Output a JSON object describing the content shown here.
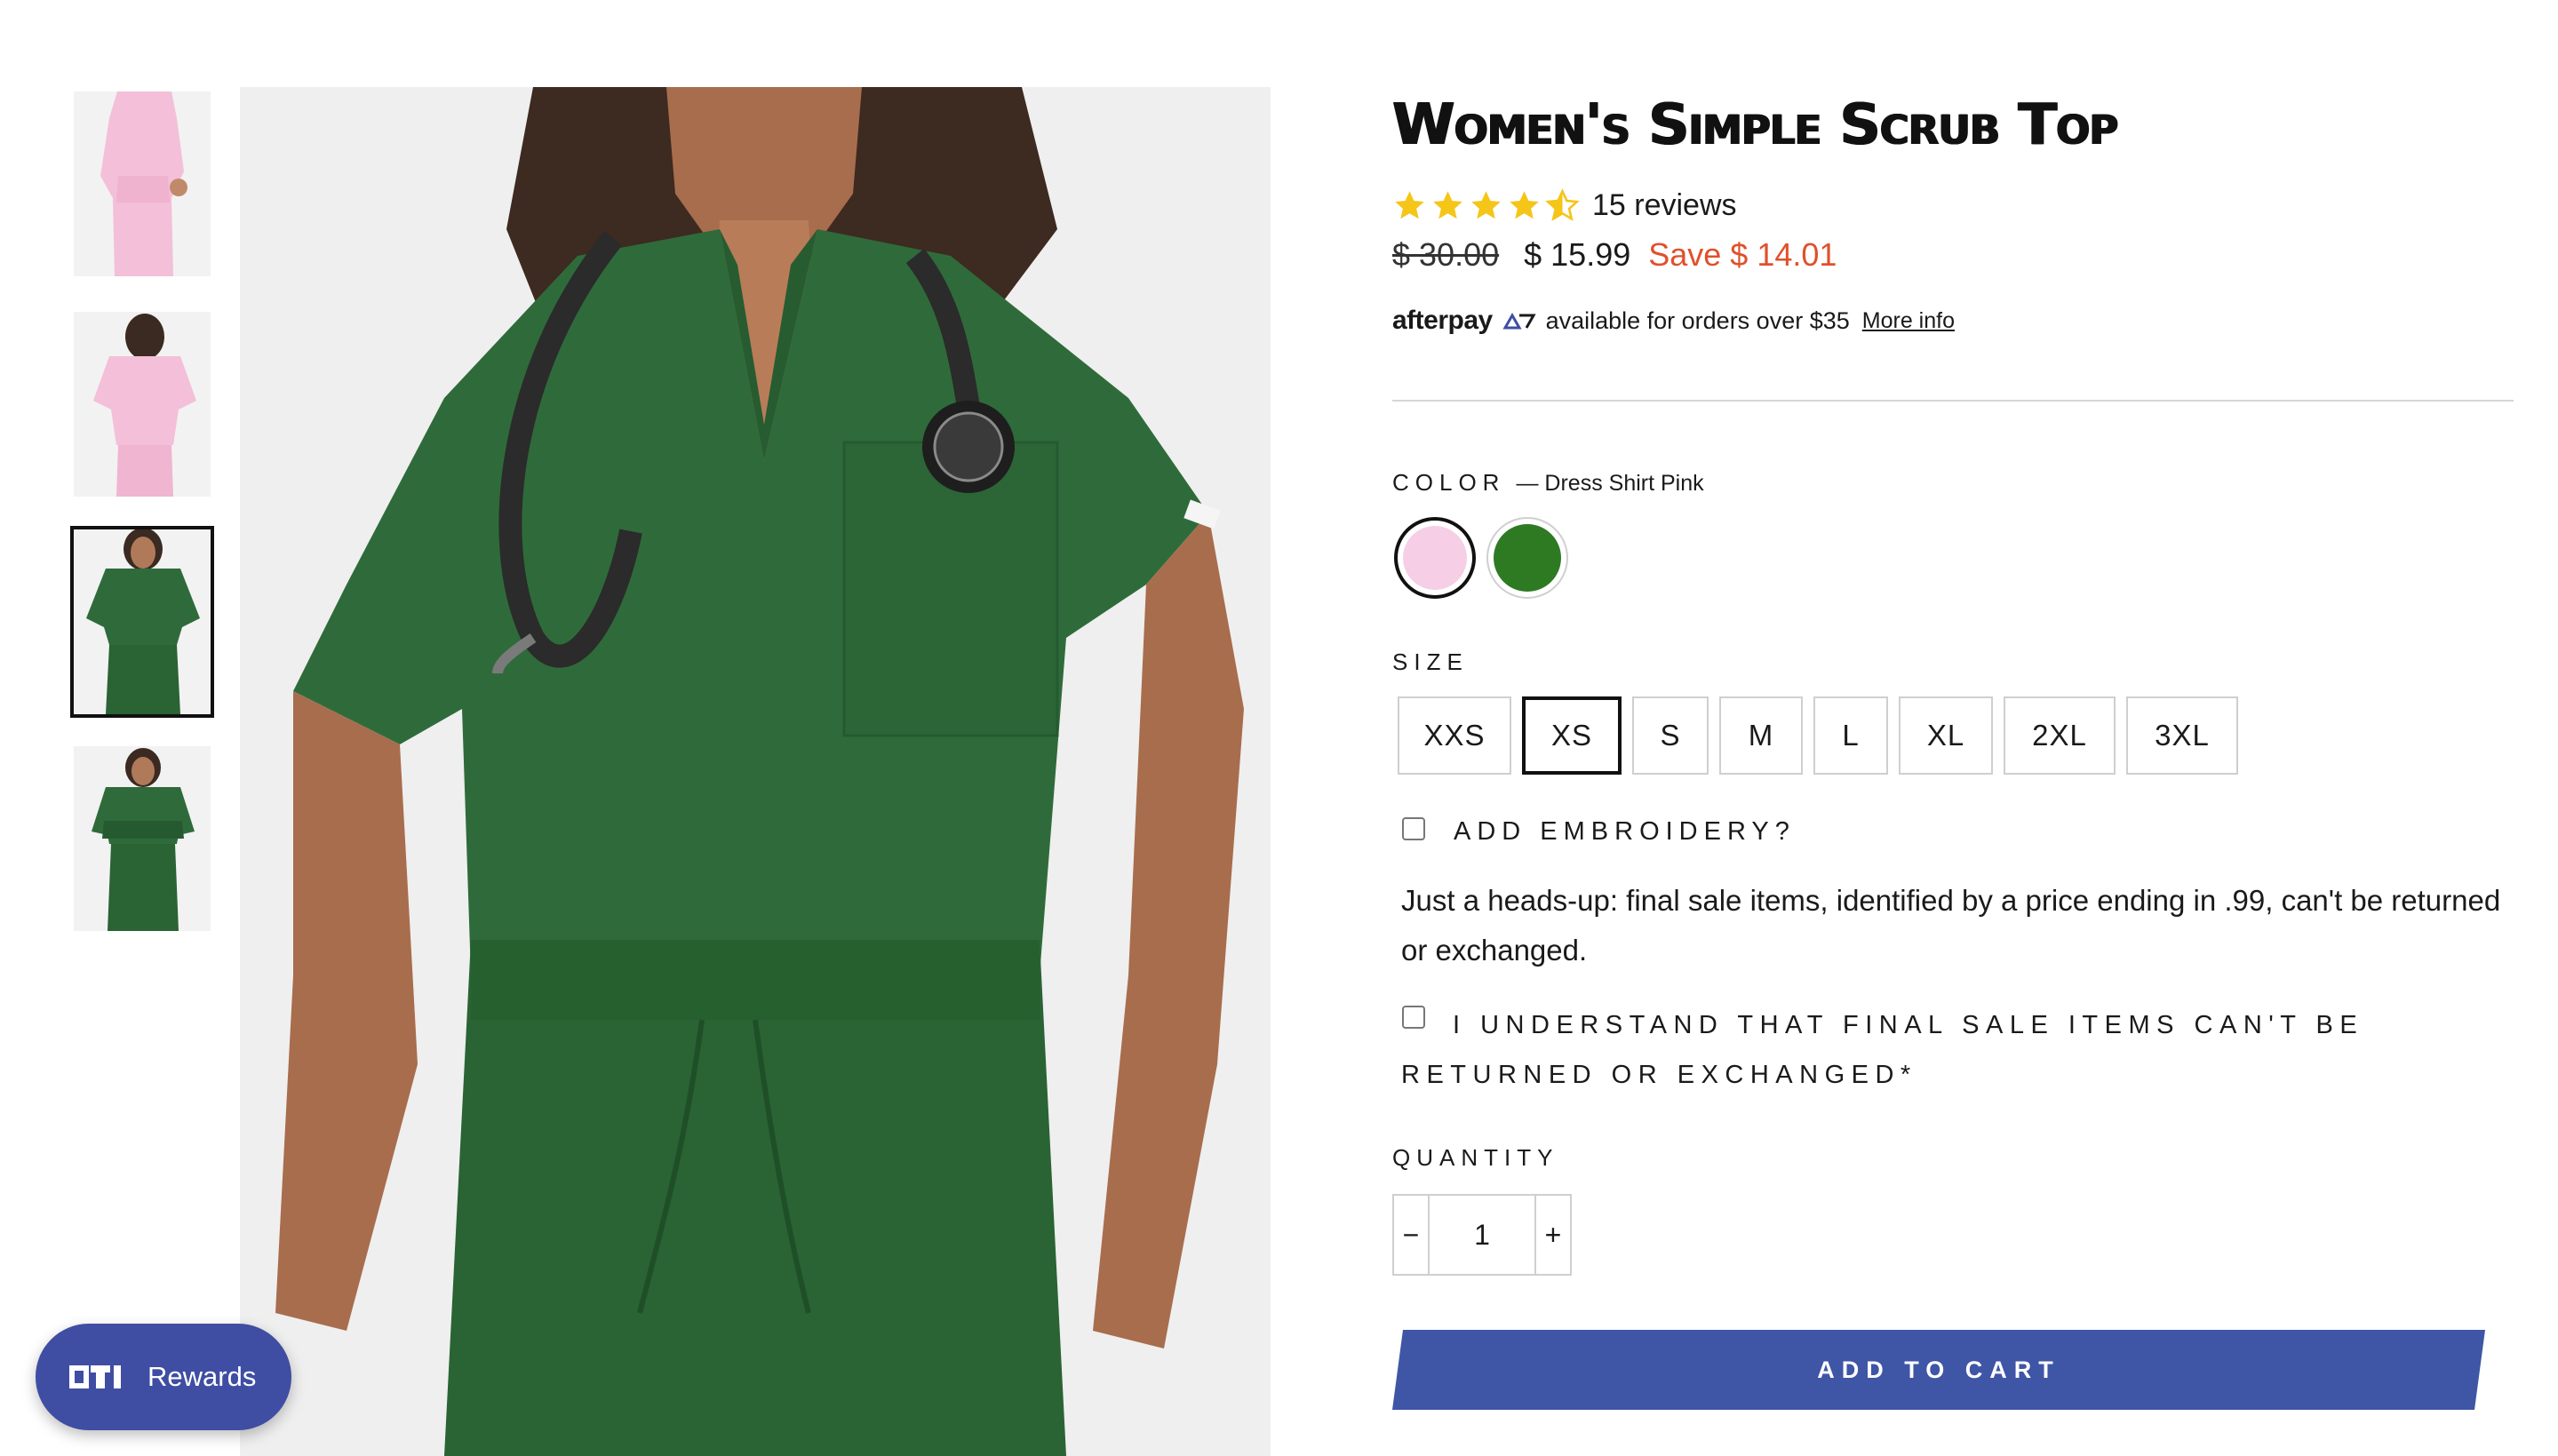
{
  "product": {
    "title": "Women's Simple Scrub Top",
    "rating": 4.5,
    "reviews_label": "15 reviews",
    "old_price": "$ 30.00",
    "new_price": "$ 15.99",
    "save_label": "Save $ 14.01"
  },
  "afterpay": {
    "logo": "afterpay",
    "text": "available for orders over $35",
    "more_info": "More info"
  },
  "color": {
    "label": "COLOR",
    "selected_value": "— Dress Shirt Pink",
    "swatches": [
      {
        "name": "Dress Shirt Pink",
        "hex": "#f6cfe6",
        "selected": true
      },
      {
        "name": "Green",
        "hex": "#2e7a23",
        "selected": false
      }
    ]
  },
  "size": {
    "label": "SIZE",
    "options": [
      "XXS",
      "XS",
      "S",
      "M",
      "L",
      "XL",
      "2XL",
      "3XL"
    ],
    "selected": "XS"
  },
  "embroidery": {
    "label": "ADD EMBROIDERY?"
  },
  "notice": "Just a heads-up: final sale items, identified by a price ending in .99, can't be returned or exchanged.",
  "understand": {
    "label": "I UNDERSTAND THAT FINAL SALE ITEMS CAN'T BE RETURNED OR EXCHANGED*"
  },
  "quantity": {
    "label": "QUANTITY",
    "value": "1",
    "minus": "−",
    "plus": "+"
  },
  "cart": {
    "label": "ADD TO CART"
  },
  "rewards": {
    "label": "Rewards"
  },
  "colors": {
    "accent": "#3f4ea3",
    "save": "#e0502b",
    "star": "#f5c518",
    "scrub_green": "#2f6b3a"
  }
}
